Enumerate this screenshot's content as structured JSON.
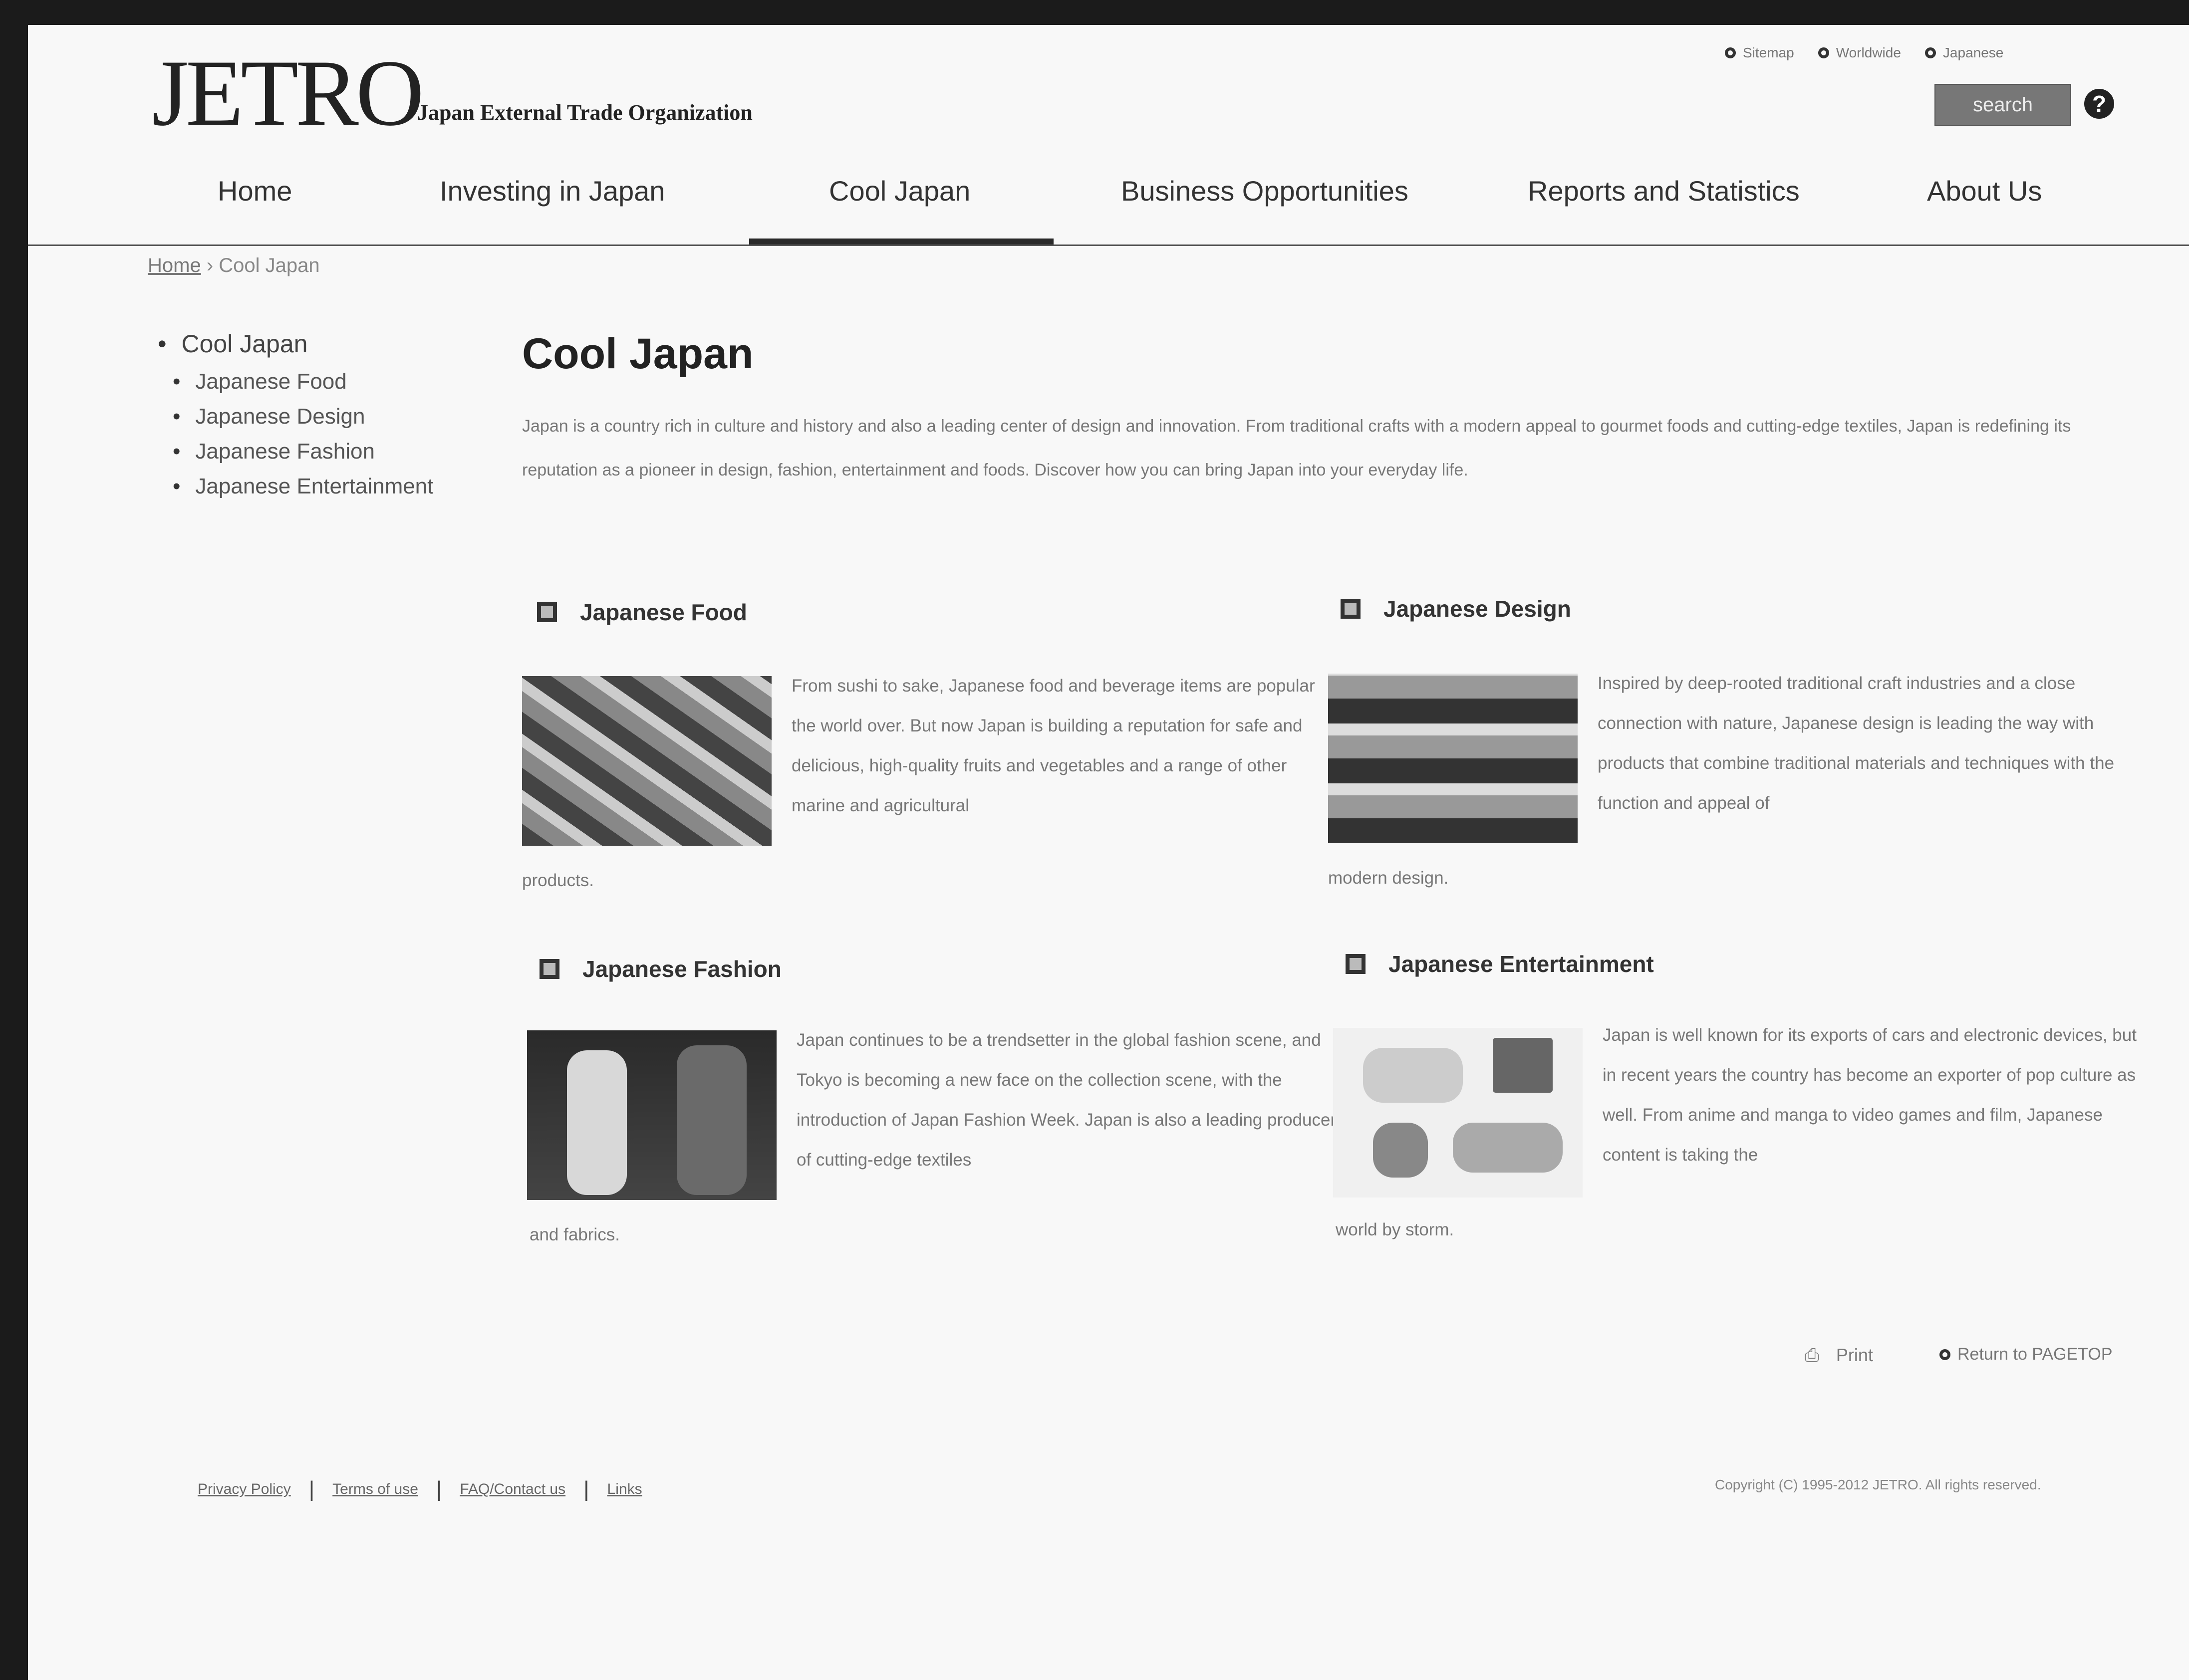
{
  "header": {
    "logo_text": "JETRO",
    "org_name": "Japan External Trade Organization",
    "util_links": [
      "Sitemap",
      "Worldwide",
      "Japanese"
    ],
    "search_label": "search",
    "help_label": "?"
  },
  "nav": {
    "items": [
      "Home",
      "Investing in Japan",
      "Cool Japan",
      "Business Opportunities",
      "Reports and Statistics",
      "About Us"
    ],
    "active": "Cool Japan"
  },
  "breadcrumb": {
    "home": "Home",
    "current": "Cool Japan"
  },
  "sidebar": {
    "title": "Cool Japan",
    "items": [
      "Japanese Food",
      "Japanese Design",
      "Japanese Fashion",
      "Japanese Entertainment"
    ]
  },
  "main": {
    "title": "Cool Japan",
    "intro": "Japan is a country rich in culture and history and also a leading center of design and innovation. From traditional crafts with a modern appeal to gourmet foods and cutting-edge textiles, Japan is redefining its reputation as a pioneer in design, fashion, entertainment and foods. Discover how you can bring Japan into your everyday life.",
    "cards": [
      {
        "title": "Japanese Food",
        "text": "From sushi to sake, Japanese food and beverage items are popular the world over. But now Japan is building a reputation for safe and delicious, high-quality fruits and vegetables and a range of other marine and agricultural",
        "tail": "products."
      },
      {
        "title": "Japanese Design",
        "text": "Inspired by deep-rooted traditional craft industries and a close connection with nature, Japanese design is leading the way with products that combine traditional materials and techniques with the function and appeal of",
        "tail": "modern design."
      },
      {
        "title": "Japanese Fashion",
        "text": "Japan continues to be a trendsetter in the global fashion scene, and Tokyo is becoming a new face on the collection scene, with the introduction of Japan Fashion Week. Japan is also a leading producer of cutting-edge textiles",
        "tail": "and fabrics."
      },
      {
        "title": "Japanese Entertainment",
        "text": "Japan is well known for its exports of cars and electronic devices, but in recent years the country has become an exporter of pop culture as well. From anime and manga to video games and film, Japanese content is taking the",
        "tail": "world by storm."
      }
    ]
  },
  "footer": {
    "print_label": "Print",
    "pagetop_label": "Return to PAGETOP",
    "links": [
      "Privacy Policy",
      "Terms of use",
      "FAQ/Contact us",
      "Links"
    ],
    "copyright": "Copyright (C) 1995-2012 JETRO. All rights reserved."
  }
}
